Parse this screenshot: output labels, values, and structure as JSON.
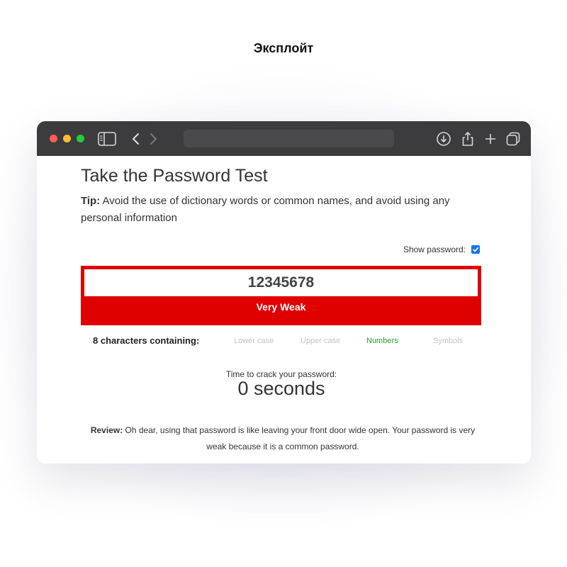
{
  "brand": {
    "title": "Эксплойт"
  },
  "browser": {
    "toolbar_icons": [
      "sidebar-icon",
      "back-icon",
      "forward-icon",
      "download-icon",
      "share-icon",
      "new-tab-icon",
      "tabs-overview-icon"
    ]
  },
  "page": {
    "title": "Take the Password Test",
    "tip_label": "Tip:",
    "tip_text": " Avoid the use of dictionary words or common names, and avoid using any personal information",
    "show_password_label": "Show password:",
    "show_password_checked": true,
    "password_value": "12345678",
    "strength_label": "Very Weak",
    "strength_color": "#e00000",
    "criteria_summary": "8 characters containing:",
    "criteria": {
      "lower": "Lower case",
      "upper": "Upper case",
      "numbers": "Numbers",
      "symbols": "Symbols"
    },
    "criteria_met": {
      "lower": false,
      "upper": false,
      "numbers": true,
      "symbols": false
    },
    "met_color": "#2a9d2a",
    "unmet_color": "#c4c4c4",
    "crack_label": "Time to crack your password:",
    "crack_time": "0 seconds",
    "review_label": "Review:",
    "review_text": " Oh dear, using that password is like leaving your front door wide open. Your password is very weak because it is a common password."
  }
}
